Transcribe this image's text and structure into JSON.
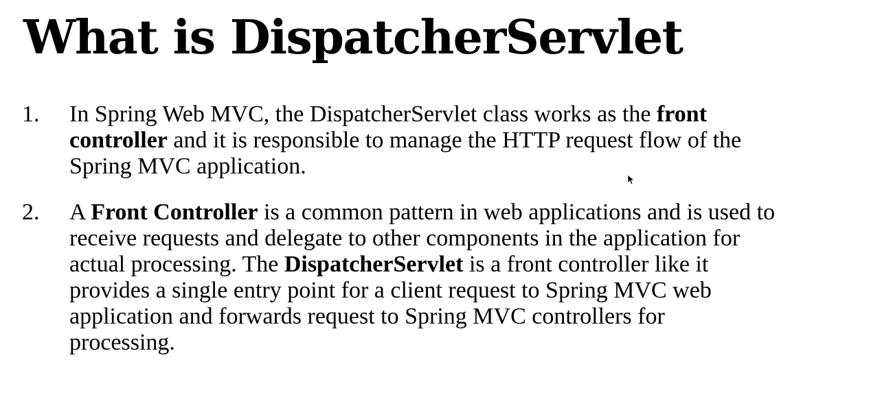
{
  "title": "What is DispatcherServlet",
  "items": [
    {
      "number": "1.",
      "lines": [
        [
          "In Spring Web MVC, the DispatcherServlet class works as the ",
          "front",
          ""
        ],
        [
          "",
          "controller",
          " and it is responsible to manage the HTTP request flow of the"
        ],
        [
          "Spring MVC application.",
          "",
          ""
        ]
      ]
    },
    {
      "number": "2.",
      "lines": [
        [
          "A ",
          "Front Controller",
          " is a common pattern in web applications and is used to"
        ],
        [
          "receive requests and delegate to other components in the application for",
          "",
          ""
        ],
        [
          "actual processing. The ",
          "DispatcherServlet",
          " is a front controller like it"
        ],
        [
          "provides a single entry point for a client request to Spring MVC web",
          "",
          ""
        ],
        [
          "application and forwards request to Spring MVC controllers for",
          "",
          ""
        ],
        [
          "processing.",
          "",
          ""
        ]
      ]
    }
  ],
  "icons": {
    "cursor": "mouse-pointer-icon"
  }
}
